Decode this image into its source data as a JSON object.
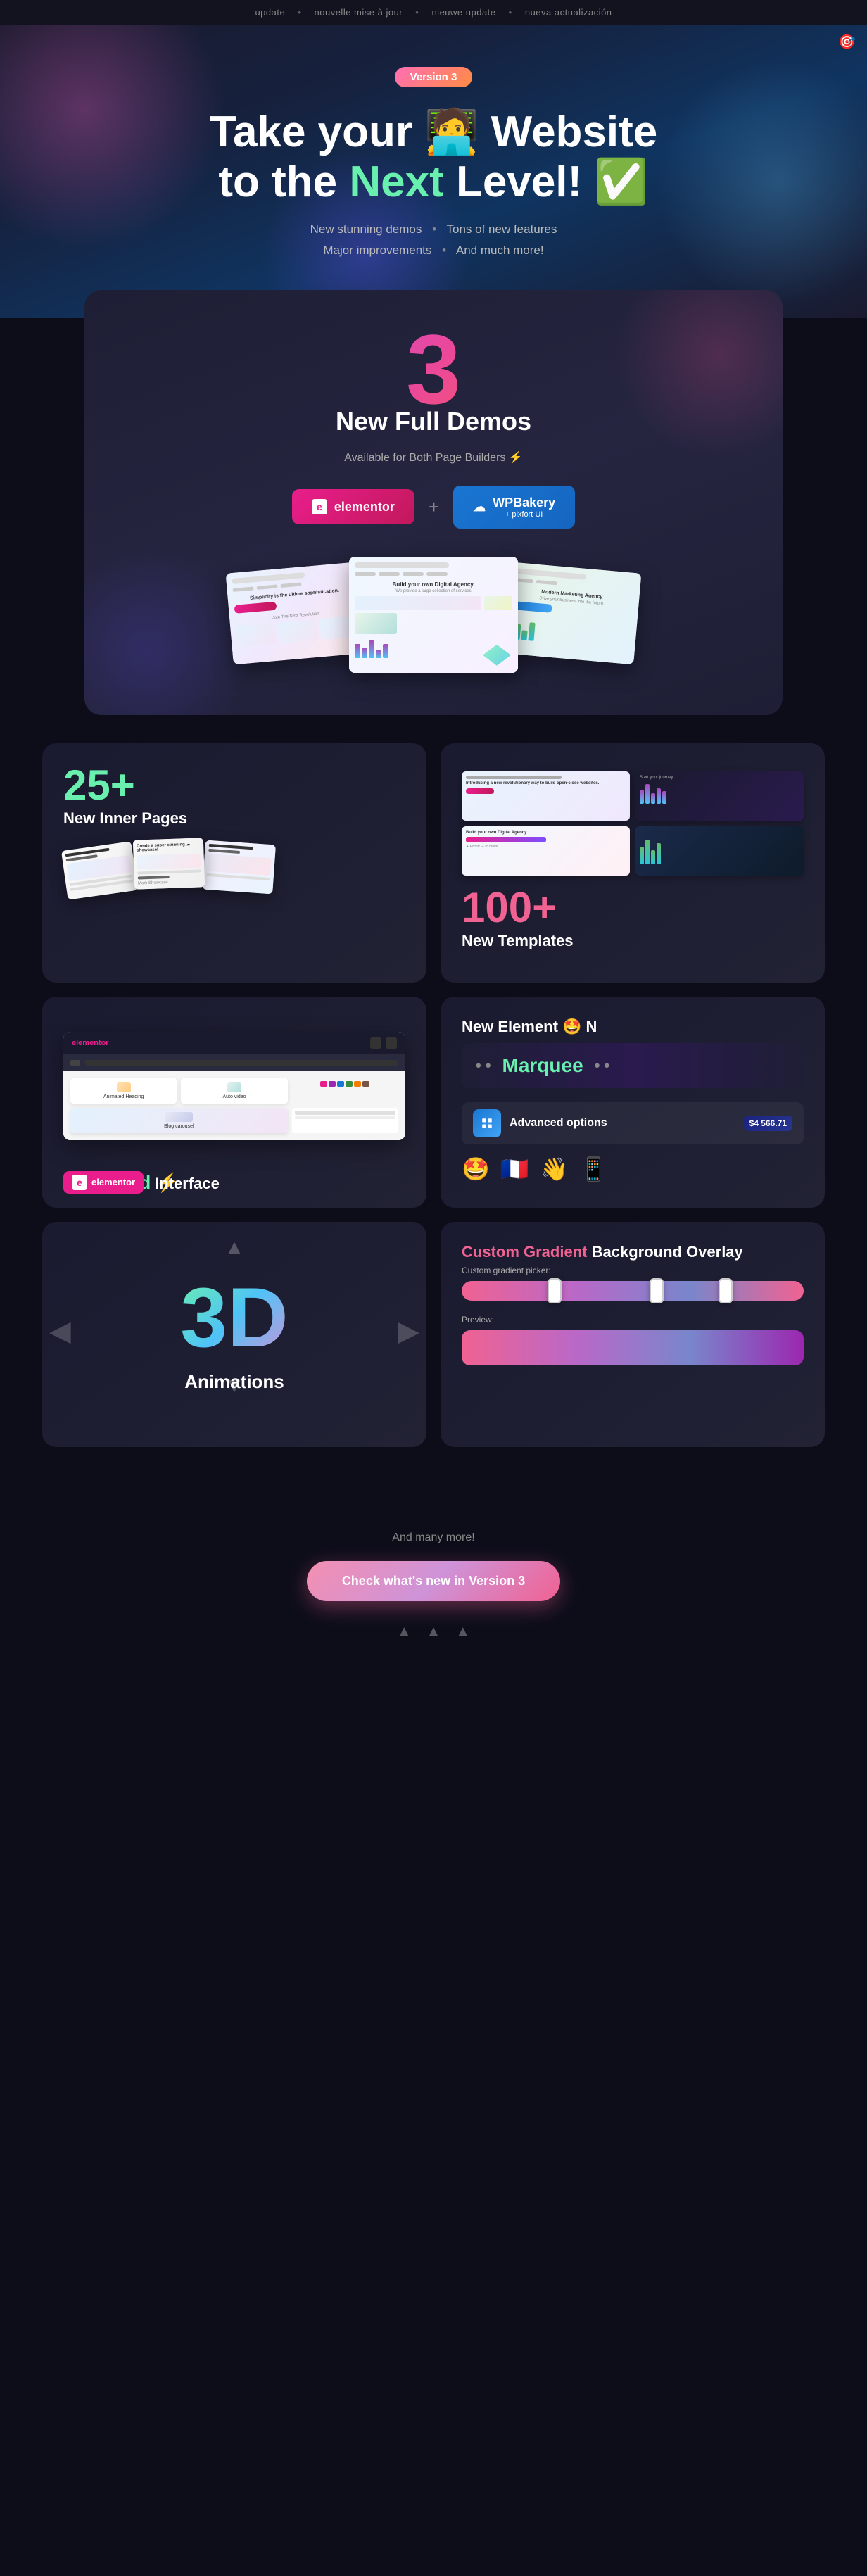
{
  "ticker": {
    "items": [
      "update",
      "nouvelle mise à jour",
      "nieuwe update",
      "nueva actualización"
    ]
  },
  "hero": {
    "version_badge": "Version 3",
    "headline_line1": "Take your 🧑‍💻 Website",
    "headline_line2_prefix": "to the ",
    "headline_highlight1": "Next",
    "headline_highlight2": " Level!",
    "headline_emoji": "✅",
    "features": [
      "New stunning demos",
      "Tons of new features",
      "Major improvements",
      "And much more!"
    ],
    "dot": "•"
  },
  "demos": {
    "number": "3",
    "title": "New Full Demos",
    "subtitle": "Available for Both Page Builders ⚡",
    "elementor_label": "elementor",
    "wpbakery_label": "WPBakery",
    "wpbakery_sub": "+ pixfort UI"
  },
  "inner_pages": {
    "number": "25+",
    "label": "New Inner Pages"
  },
  "templates": {
    "number": "100+",
    "label": "New Templates"
  },
  "elementor": {
    "animated_heading_label": "Animated Heading",
    "auto_video_label": "Auto video",
    "blog_carousel_label": "Blog carousel",
    "enhanced_label": "Enhanced ⚡",
    "interface_label": "Interface",
    "elementor_badge": "elementor"
  },
  "marquee": {
    "new_element_label": "New Element 🤩 N",
    "dots": "• •",
    "marquee_text": "Marquee",
    "dots2": "• •",
    "advanced_options_label": "Advanced options",
    "price": "$4 566.71",
    "emojis": [
      "🤩",
      "🇫🇷",
      "👋",
      "📱"
    ]
  },
  "threed": {
    "text": "3D",
    "label": "Animations"
  },
  "gradient": {
    "title_highlight": "Custom Gradient",
    "title_rest": " Background Overlay",
    "picker_label": "Custom gradient picker:",
    "preview_label": "Preview:"
  },
  "cta": {
    "and_many_more": "And many more!",
    "button_label": "Check what's new in Version 3"
  },
  "icons": {
    "ticker_dot": "•",
    "top_right": "🎯",
    "up_arrow": "▲",
    "left_arrow": "◀",
    "right_arrow": "▶",
    "down_arrow": "▼",
    "arrow_up": "↑",
    "arrow_down": "↓",
    "lightning": "⚡",
    "check": "✅",
    "waving_hand": "👋",
    "france_flag": "🇫🇷",
    "star_struck": "🤩",
    "phone": "📱"
  }
}
